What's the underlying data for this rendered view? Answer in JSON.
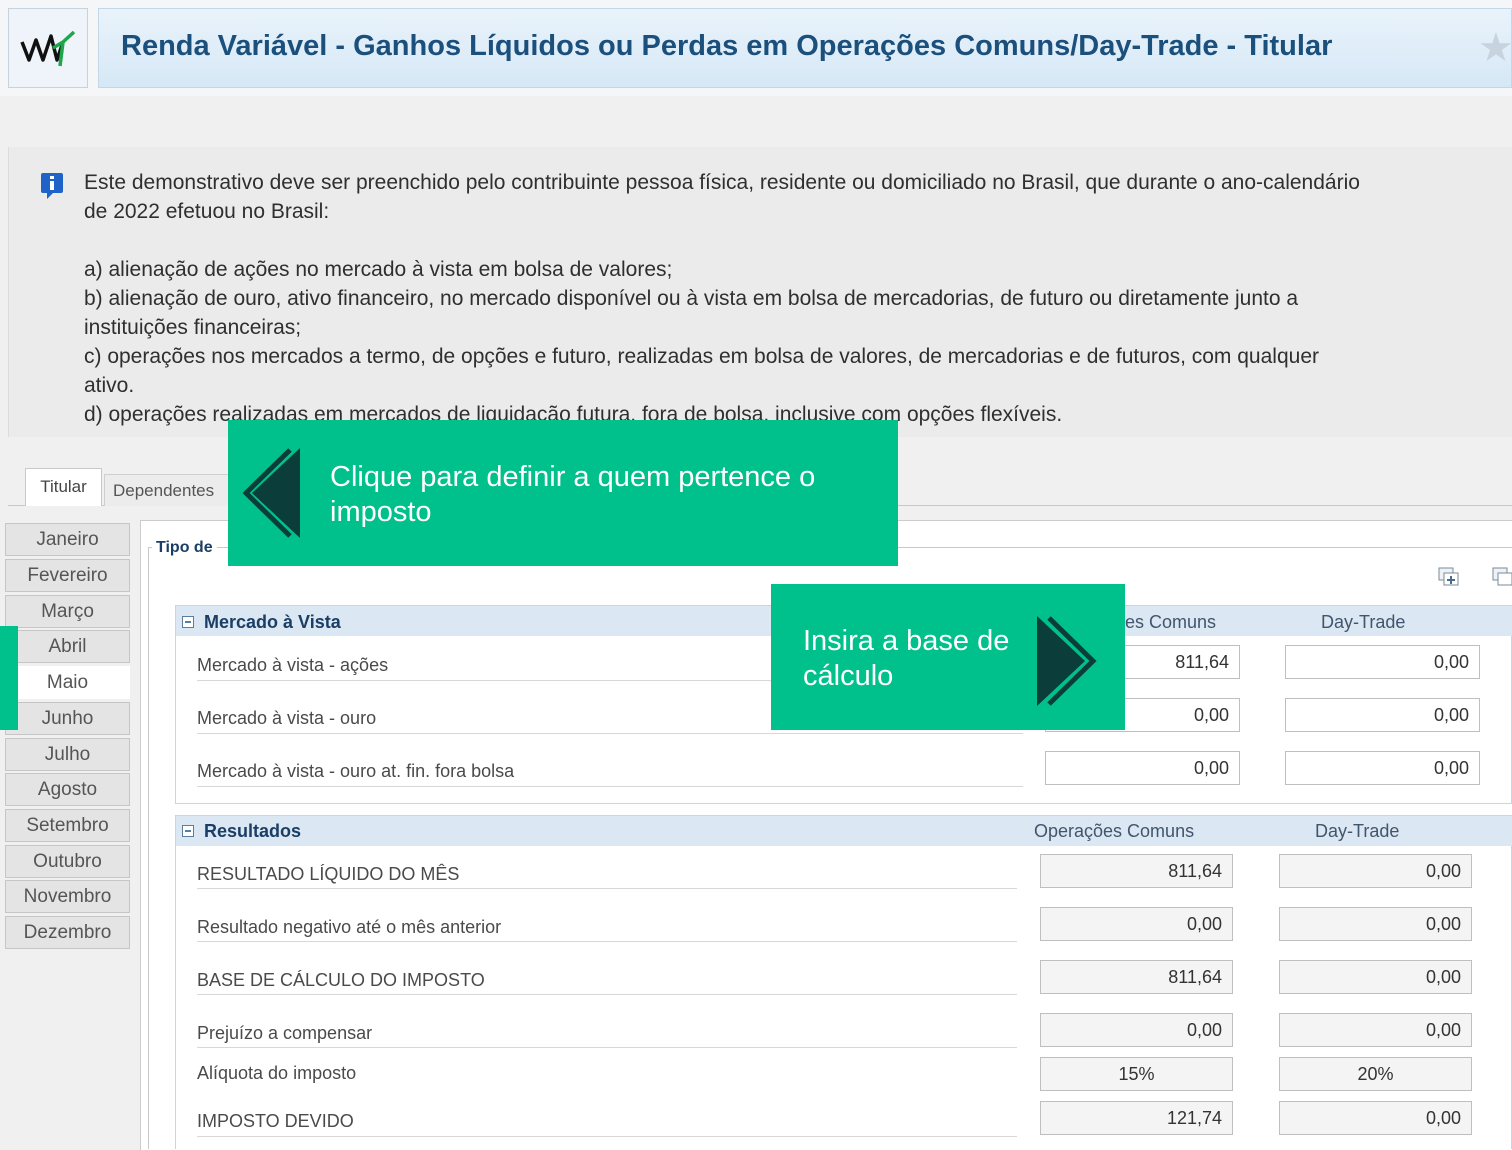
{
  "header": {
    "title": "Renda Variável - Ganhos Líquidos ou Perdas em Operações Comuns/Day-Trade - Titular"
  },
  "info": {
    "lines": [
      "Este demonstrativo deve ser preenchido pelo contribuinte pessoa física, residente ou domiciliado no Brasil, que durante o ano-calendário",
      "de 2022 efetuou no Brasil:",
      "a) alienação de ações no mercado à vista em bolsa de valores;",
      "b) alienação de ouro, ativo financeiro, no mercado disponível ou à vista em bolsa de mercadorias, de futuro ou diretamente junto a",
      "instituições financeiras;",
      "c) operações nos mercados a termo, de opções e futuro, realizadas em bolsa de valores, de mercadorias e de futuros, com qualquer",
      "ativo.",
      "d) operações realizadas em mercados de liquidação futura, fora de bolsa, inclusive com opções flexíveis."
    ]
  },
  "tabs": [
    "Titular",
    "Dependentes"
  ],
  "months": [
    "Janeiro",
    "Fevereiro",
    "Março",
    "Abril",
    "Maio",
    "Junho",
    "Julho",
    "Agosto",
    "Setembro",
    "Outubro",
    "Novembro",
    "Dezembro"
  ],
  "selected_month": "Maio",
  "group_legend": "Tipo de",
  "mercado": {
    "title": "Mercado à Vista",
    "col_comuns": "es Comuns",
    "col_daytrade": "Day-Trade",
    "rows": [
      {
        "label": "Mercado à vista - ações",
        "comuns": "811,64",
        "daytrade": "0,00"
      },
      {
        "label": "Mercado à vista - ouro",
        "comuns": "0,00",
        "daytrade": "0,00"
      },
      {
        "label": "Mercado à vista - ouro at. fin. fora bolsa",
        "comuns": "0,00",
        "daytrade": "0,00"
      }
    ]
  },
  "resultados": {
    "title": "Resultados",
    "col_comuns": "Operações Comuns",
    "col_daytrade": "Day-Trade",
    "rows": [
      {
        "label": "RESULTADO LÍQUIDO DO MÊS",
        "comuns": "811,64",
        "daytrade": "0,00"
      },
      {
        "label": "Resultado negativo até o mês anterior",
        "comuns": "0,00",
        "daytrade": "0,00"
      },
      {
        "label": "BASE DE CÁLCULO DO IMPOSTO",
        "comuns": "811,64",
        "daytrade": "0,00"
      },
      {
        "label": "Prejuízo a compensar",
        "comuns": "0,00",
        "daytrade": "0,00"
      },
      {
        "label": "Alíquota do imposto",
        "comuns": "15%",
        "daytrade": "20%"
      },
      {
        "label": "IMPOSTO DEVIDO",
        "comuns": "121,74",
        "daytrade": "0,00"
      }
    ]
  },
  "callouts": {
    "owner": "Clique para definir a quem pertence o imposto",
    "base": "Insira a base de cálculo"
  },
  "colors": {
    "accent": "#00c08b",
    "accent_dark": "#0b3d3a",
    "title_blue": "#1b4f7c"
  }
}
